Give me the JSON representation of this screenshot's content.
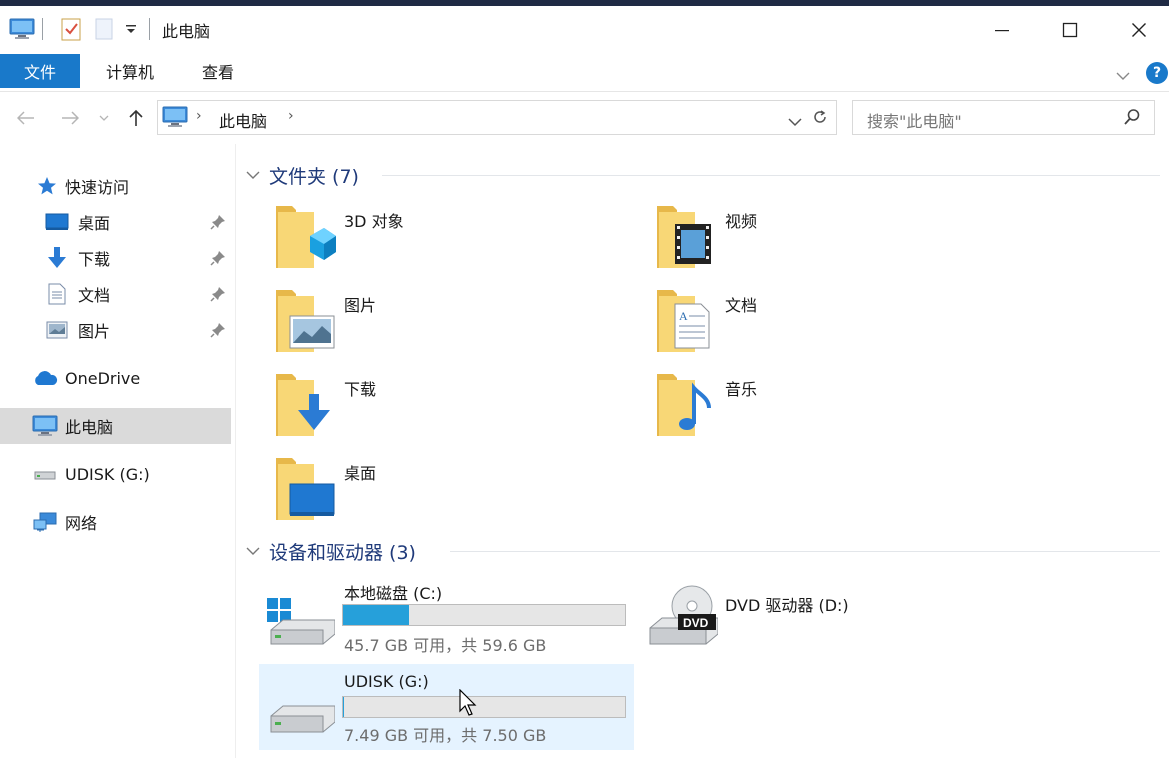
{
  "window": {
    "title": "此电脑",
    "controls": [
      "minimize",
      "maximize",
      "close"
    ]
  },
  "ribbon": {
    "tabs": [
      {
        "label": "文件",
        "active": true
      },
      {
        "label": "计算机",
        "active": false
      },
      {
        "label": "查看",
        "active": false
      }
    ],
    "help_label": "?"
  },
  "address": {
    "path": [
      "此电脑"
    ],
    "search_placeholder": "搜索\"此电脑\""
  },
  "sidebar": {
    "quick_access": {
      "label": "快速访问",
      "icon": "star-icon"
    },
    "items": [
      {
        "label": "桌面",
        "icon": "desktop-icon",
        "pinned": true
      },
      {
        "label": "下载",
        "icon": "download-icon",
        "pinned": true
      },
      {
        "label": "文档",
        "icon": "document-icon",
        "pinned": true
      },
      {
        "label": "图片",
        "icon": "picture-icon",
        "pinned": true
      }
    ],
    "onedrive": "OneDrive",
    "this_pc": "此电脑",
    "udisk": "UDISK (G:)",
    "network": "网络"
  },
  "content": {
    "folders_header": "文件夹 (7)",
    "folders": [
      {
        "label": "3D 对象",
        "icon": "3d-objects-icon"
      },
      {
        "label": "视频",
        "icon": "videos-icon"
      },
      {
        "label": "图片",
        "icon": "pictures-folder-icon"
      },
      {
        "label": "文档",
        "icon": "documents-folder-icon"
      },
      {
        "label": "下载",
        "icon": "downloads-folder-icon"
      },
      {
        "label": "音乐",
        "icon": "music-folder-icon"
      },
      {
        "label": "桌面",
        "icon": "desktop-folder-icon"
      }
    ],
    "devices_header": "设备和驱动器 (3)",
    "drives": [
      {
        "name": "本地磁盘 (C:)",
        "free_text": "45.7 GB 可用，共 59.6 GB",
        "used_fraction": 0.233,
        "icon": "windows-drive-icon"
      },
      {
        "name": "DVD 驱动器 (D:)",
        "icon": "dvd-drive-icon",
        "badge": "DVD"
      },
      {
        "name": "UDISK (G:)",
        "free_text": "7.49 GB 可用，共 7.50 GB",
        "used_fraction": 0.001,
        "icon": "usb-drive-icon"
      }
    ]
  },
  "colors": {
    "accent": "#1979ca",
    "header_text": "#1f3a7a",
    "bar_fill": "#26a0da",
    "selected_bg": "#dadada",
    "hover_bg": "#e5f3ff"
  }
}
